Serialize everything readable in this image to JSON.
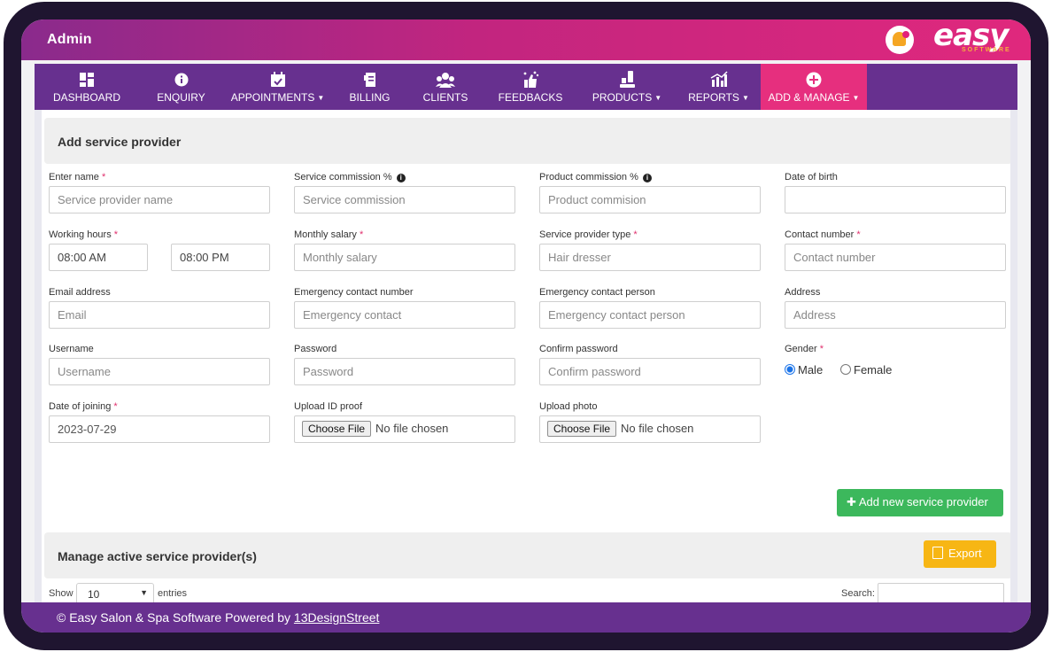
{
  "header": {
    "title": "Admin",
    "logo_text": "easy",
    "logo_sub": "SOFTWARE",
    "colors": {
      "gradient_start": "#8a2a8c",
      "gradient_end": "#e0287d",
      "nav": "#67308f",
      "nav_active": "#e62f7e"
    }
  },
  "nav": [
    {
      "label": "DASHBOARD",
      "icon": "dashboard-icon",
      "dropdown": false
    },
    {
      "label": "ENQUIRY",
      "icon": "info-icon",
      "dropdown": false
    },
    {
      "label": "APPOINTMENTS",
      "icon": "calendar-icon",
      "dropdown": true
    },
    {
      "label": "BILLING",
      "icon": "receipt-icon",
      "dropdown": false
    },
    {
      "label": "CLIENTS",
      "icon": "users-icon",
      "dropdown": false
    },
    {
      "label": "FEEDBACKS",
      "icon": "thumbs-up-icon",
      "dropdown": false
    },
    {
      "label": "PRODUCTS",
      "icon": "products-icon",
      "dropdown": true
    },
    {
      "label": "REPORTS",
      "icon": "chart-icon",
      "dropdown": true
    },
    {
      "label": "ADD & MANAGE",
      "icon": "plus-circle-icon",
      "dropdown": true,
      "active": true
    }
  ],
  "form": {
    "heading": "Add service provider",
    "fields": {
      "name": {
        "label": "Enter name",
        "required": "*",
        "placeholder": "Service provider name"
      },
      "service_commission": {
        "label": "Service commission %",
        "placeholder": "Service commission"
      },
      "product_commission": {
        "label": "Product commission %",
        "placeholder": "Product commision"
      },
      "dob": {
        "label": "Date of birth",
        "placeholder": ""
      },
      "working_hours": {
        "label": "Working hours",
        "required": "*",
        "from": "08:00 AM",
        "to": "08:00 PM"
      },
      "monthly_salary": {
        "label": "Monthly salary",
        "required": "*",
        "placeholder": "Monthly salary"
      },
      "provider_type": {
        "label": "Service provider type",
        "required": "*",
        "value": "Hair dresser"
      },
      "contact_number": {
        "label": "Contact number",
        "required": "*",
        "placeholder": "Contact number"
      },
      "email": {
        "label": "Email address",
        "placeholder": "Email"
      },
      "emergency_number": {
        "label": "Emergency contact number",
        "placeholder": "Emergency contact"
      },
      "emergency_person": {
        "label": "Emergency contact person",
        "placeholder": "Emergency contact person"
      },
      "address": {
        "label": "Address",
        "placeholder": "Address"
      },
      "username": {
        "label": "Username",
        "placeholder": "Username"
      },
      "password": {
        "label": "Password",
        "placeholder": "Password"
      },
      "confirm_password": {
        "label": "Confirm password",
        "placeholder": "Confirm password"
      },
      "gender": {
        "label": "Gender",
        "required": "*",
        "options": [
          "Male",
          "Female"
        ],
        "selected": "Male"
      },
      "joining": {
        "label": "Date of joining",
        "required": "*",
        "value": "2023-07-29"
      },
      "id_proof": {
        "label": "Upload ID proof",
        "button": "Choose File",
        "status": "No file chosen"
      },
      "photo": {
        "label": "Upload photo",
        "button": "Choose File",
        "status": "No file chosen"
      }
    },
    "submit_label": "Add new service provider"
  },
  "manage": {
    "heading": "Manage active service provider(s)",
    "export_label": "Export",
    "show_label": "Show",
    "entries_value": "10",
    "entries_label": "entries",
    "search_label": "Search:"
  },
  "footer": {
    "text": "© Easy Salon & Spa Software Powered by",
    "link": "13DesignStreet"
  }
}
